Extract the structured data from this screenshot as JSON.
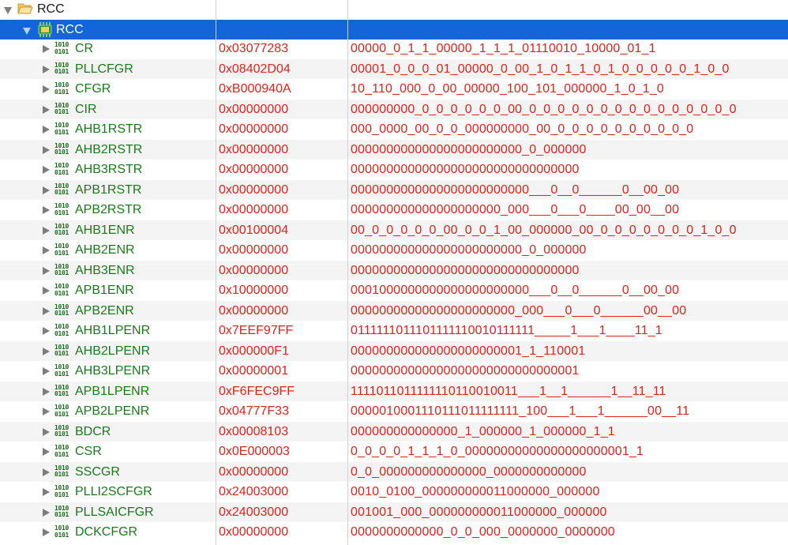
{
  "root": {
    "label": "RCC"
  },
  "peripheral": {
    "label": "RCC"
  },
  "registers": [
    {
      "name": "CR",
      "value": "0x03077283",
      "bits": "00000_0_1_1_00000_1_1_1_01110010_10000_01_1"
    },
    {
      "name": "PLLCFGR",
      "value": "0x08402D04",
      "bits": "00001_0_0_0_01_00000_0_00_1_0_1_1_0_1_0_0_0_0_0_1_0_0"
    },
    {
      "name": "CFGR",
      "value": "0xB000940A",
      "bits": "10_110_000_0_00_00000_100_101_000000_1_0_1_0"
    },
    {
      "name": "CIR",
      "value": "0x00000000",
      "bits": "000000000_0_0_0_0_0_0_00_0_0_0_0_0_0_0_0_0_0_0_0_0_0_0"
    },
    {
      "name": "AHB1RSTR",
      "value": "0x00000000",
      "bits": "000_0000_00_0_0_000000000_00_0_0_0_0_0_0_0_0_0_0"
    },
    {
      "name": "AHB2RSTR",
      "value": "0x00000000",
      "bits": "000000000000000000000000_0_000000"
    },
    {
      "name": "AHB3RSTR",
      "value": "0x00000000",
      "bits": "00000000000000000000000000000000"
    },
    {
      "name": "APB1RSTR",
      "value": "0x00000000",
      "bits": "0000000000000000000000000___0__0______0__00_00"
    },
    {
      "name": "APB2RSTR",
      "value": "0x00000000",
      "bits": "000000000000000000000_000___0___0____00_00__00"
    },
    {
      "name": "AHB1ENR",
      "value": "0x00100004",
      "bits": "00_0_0_0_0_0_00_0_0_1_00_000000_00_0_0_0_0_0_0_0_1_0_0"
    },
    {
      "name": "AHB2ENR",
      "value": "0x00000000",
      "bits": "000000000000000000000000_0_000000"
    },
    {
      "name": "AHB3ENR",
      "value": "0x00000000",
      "bits": "00000000000000000000000000000000"
    },
    {
      "name": "APB1ENR",
      "value": "0x10000000",
      "bits": "0001000000000000000000000___0__0______0__00_00"
    },
    {
      "name": "APB2ENR",
      "value": "0x00000000",
      "bits": "00000000000000000000000_000___0___0______00__00"
    },
    {
      "name": "AHB1LPENR",
      "value": "0x7EEF97FF",
      "bits": "0111111011101111110010111111_____1___1____11_1"
    },
    {
      "name": "AHB2LPENR",
      "value": "0x000000F1",
      "bits": "000000000000000000000001_1_110001"
    },
    {
      "name": "AHB3LPENR",
      "value": "0x00000001",
      "bits": "00000000000000000000000000000001"
    },
    {
      "name": "APB1LPENR",
      "value": "0xF6FEC9FF",
      "bits": "1111011011111110110010011___1__1______1__11_11"
    },
    {
      "name": "APB2LPENR",
      "value": "0x04777F33",
      "bits": "0000010001110111011111111_100___1___1______00__11"
    },
    {
      "name": "BDCR",
      "value": "0x00008103",
      "bits": "000000000000000_1_000000_1_000000_1_1"
    },
    {
      "name": "CSR",
      "value": "0x0E000003",
      "bits": "0_0_0_0_1_1_1_0_00000000000000000000001_1"
    },
    {
      "name": "SSCGR",
      "value": "0x00000000",
      "bits": "0_0_000000000000000_0000000000000"
    },
    {
      "name": "PLLI2SCFGR",
      "value": "0x24003000",
      "bits": "0010_0100_000000000011000000_000000"
    },
    {
      "name": "PLLSAICFGR",
      "value": "0x24003000",
      "bits": "001001_000_000000000011000000_000000"
    },
    {
      "name": "DCKCFGR",
      "value": "0x00000000",
      "bits": "0000000000000_0_0_000_0000000_0000000"
    }
  ]
}
